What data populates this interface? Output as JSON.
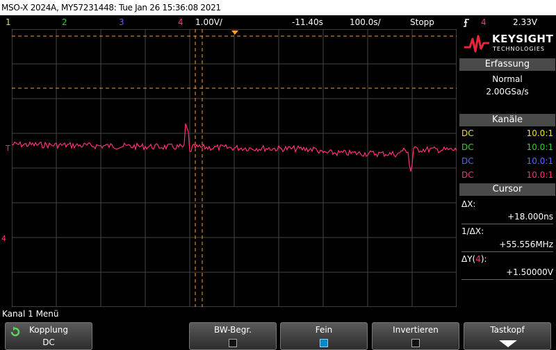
{
  "title": "MSO-X 2024A, MY57231448: Tue Jan 26 15:36:08 2021",
  "status": {
    "ch1": "1",
    "ch2": "2",
    "ch3": "3",
    "ch4": "4",
    "scale": "1.00V/",
    "time_offset": "-11.40s",
    "timebase": "100.0s/",
    "run_state": "Stopp",
    "trigger_icon": "trigger-edge-rising",
    "trigger_channel": "4",
    "trigger_level": "2.33V"
  },
  "colors": {
    "ch1": "#f2e21a",
    "ch2": "#27d62a",
    "ch3": "#5864ff",
    "ch4": "#ff2f7a",
    "cursor": "#ff9c2a",
    "grid": "#555555"
  },
  "logo": {
    "brand": "KEYSIGHT",
    "sub": "TECHNOLOGIES"
  },
  "acquisition": {
    "header": "Erfassung",
    "mode": "Normal",
    "rate": "2.00GSa/s"
  },
  "channels": {
    "header": "Kanäle",
    "rows": [
      {
        "coupling": "DC",
        "probe": "10.0:1"
      },
      {
        "coupling": "DC",
        "probe": "10.0:1"
      },
      {
        "coupling": "DC",
        "probe": "10.0:1"
      },
      {
        "coupling": "DC",
        "probe": "10.0:1"
      }
    ]
  },
  "cursor": {
    "header": "Cursor",
    "dx_label": "ΔX:",
    "dx_value": "+18.000ns",
    "inv_dx_label": "1/ΔX:",
    "inv_dx_value": "+55.556MHz",
    "dy_label_pre": "ΔY(",
    "dy_label_ch": "4",
    "dy_label_post": "):",
    "dy_value": "+1.50000V"
  },
  "menu_title": "Kanal 1 Menü",
  "softkeys": {
    "coupling": {
      "label": "Kopplung",
      "value": "DC",
      "icon": "rotate-knob-icon"
    },
    "bw_limit": {
      "label": "BW-Begr.",
      "checked": false
    },
    "fine": {
      "label": "Fein",
      "checked": true
    },
    "invert": {
      "label": "Invertieren",
      "checked": false
    },
    "probe": {
      "label": "Tastkopf",
      "icon": "arrow-down-icon"
    }
  },
  "markers": {
    "ground_ch4": "4",
    "trigger_mark": "T"
  }
}
